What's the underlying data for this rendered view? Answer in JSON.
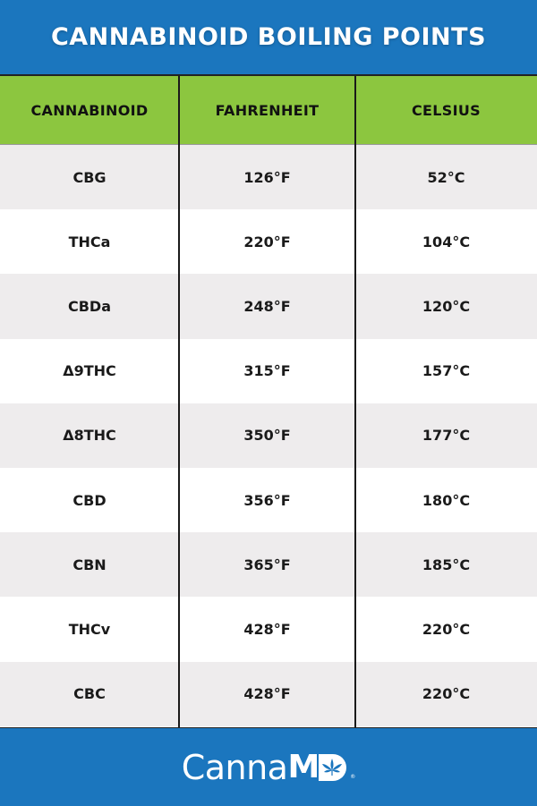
{
  "title": "CANNABINOID BOILING POINTS",
  "table": {
    "headers": [
      "CANNABINOID",
      "FAHRENHEIT",
      "CELSIUS"
    ],
    "rows": [
      {
        "name": "CBG",
        "fahrenheit": "126°F",
        "celsius": "52°C"
      },
      {
        "name": "THCa",
        "fahrenheit": "220°F",
        "celsius": "104°C"
      },
      {
        "name": "CBDa",
        "fahrenheit": "248°F",
        "celsius": "120°C"
      },
      {
        "name": "Δ9THC",
        "fahrenheit": "315°F",
        "celsius": "157°C"
      },
      {
        "name": "Δ8THC",
        "fahrenheit": "350°F",
        "celsius": "177°C"
      },
      {
        "name": "CBD",
        "fahrenheit": "356°F",
        "celsius": "180°C"
      },
      {
        "name": "CBN",
        "fahrenheit": "365°F",
        "celsius": "185°C"
      },
      {
        "name": "THCv",
        "fahrenheit": "428°F",
        "celsius": "220°C"
      },
      {
        "name": "CBC",
        "fahrenheit": "428°F",
        "celsius": "220°C"
      }
    ]
  },
  "footer": {
    "logo_light": "Canna",
    "logo_bold": "M",
    "logo_icon": "cannabis-leaf-icon",
    "registered": "®"
  },
  "colors": {
    "brand_blue": "#1b76be",
    "header_green": "#8cc63f",
    "row_alt": "#eeeced"
  }
}
